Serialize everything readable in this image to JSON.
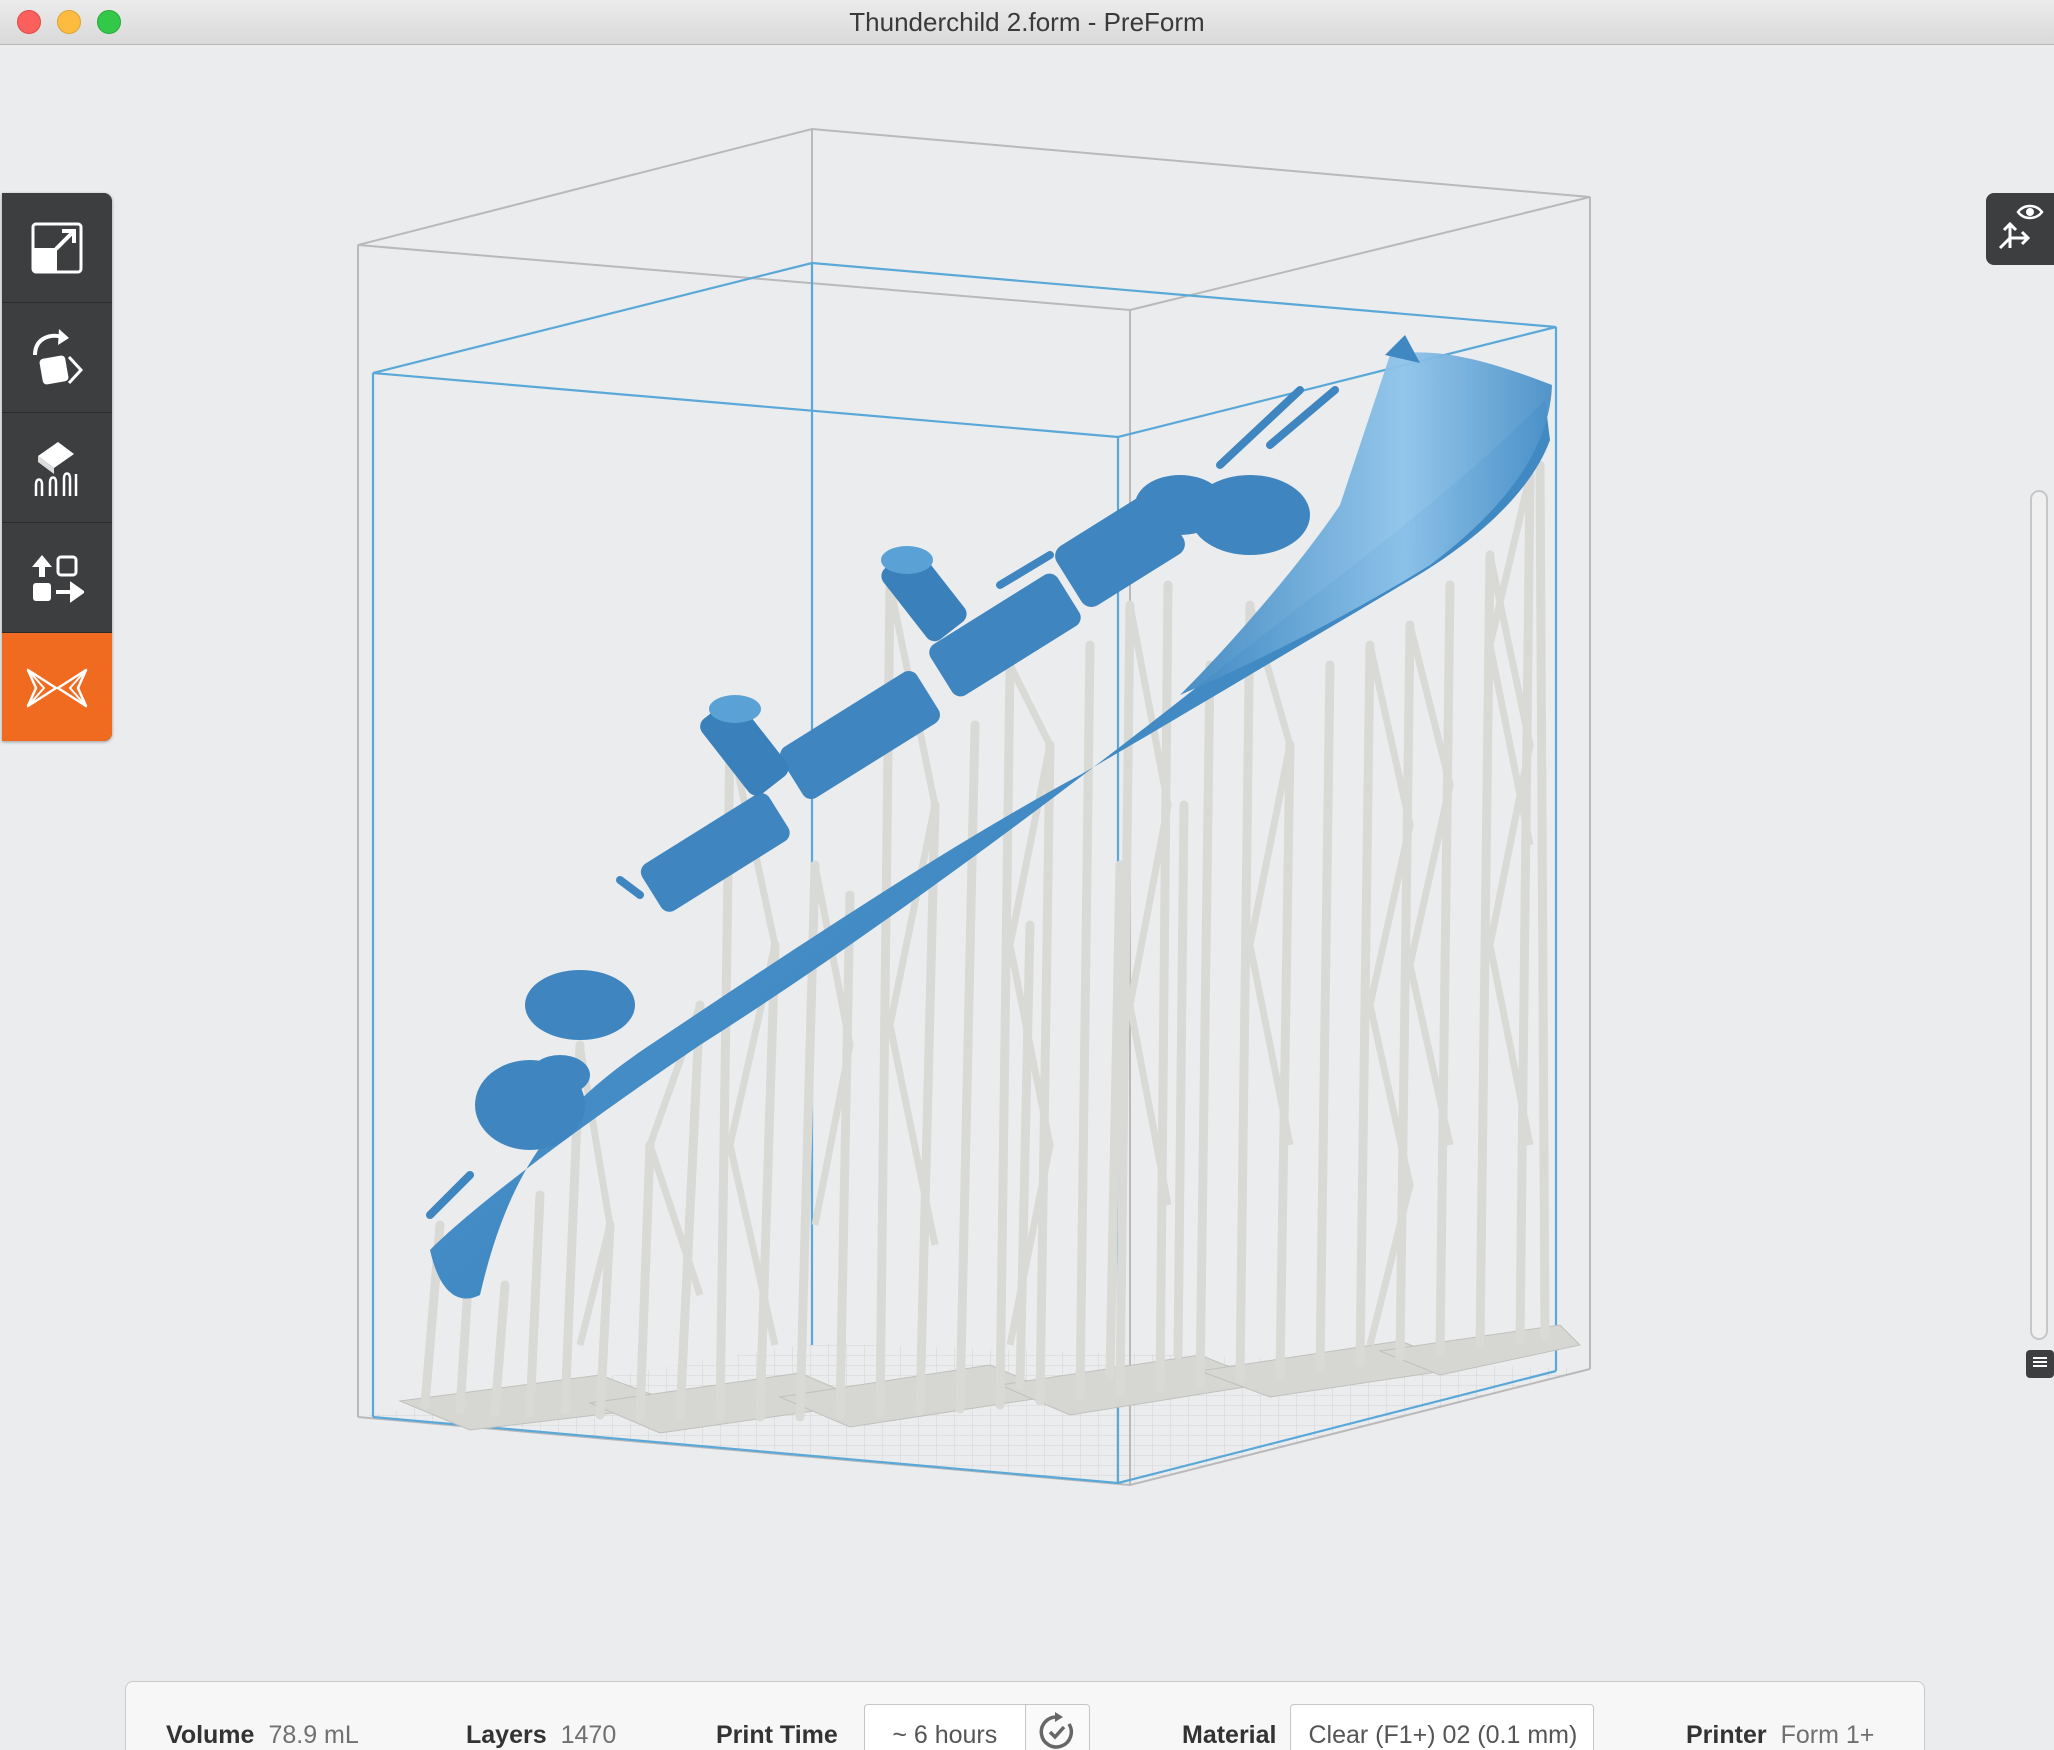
{
  "window": {
    "title": "Thunderchild 2.form - PreForm"
  },
  "toolbar": {
    "items": [
      {
        "name": "scale",
        "icon": "scale-icon"
      },
      {
        "name": "orientation",
        "icon": "rotate-icon"
      },
      {
        "name": "supports",
        "icon": "supports-icon"
      },
      {
        "name": "layout",
        "icon": "layout-icon"
      },
      {
        "name": "print",
        "icon": "formlabs-logo-icon",
        "active": true
      }
    ]
  },
  "view_panel": {
    "icon": "view-eye-icon"
  },
  "scene": {
    "model_color": "#4a90c8",
    "support_color": "#d9d9d6",
    "build_volume_color": "#5aa8d8"
  },
  "status": {
    "volume": {
      "label": "Volume",
      "value": "78.9 mL"
    },
    "layers": {
      "label": "Layers",
      "value": "1470"
    },
    "print_time": {
      "label": "Print Time",
      "value": "~ 6 hours"
    },
    "material": {
      "label": "Material",
      "value": "Clear (F1+) 02 (0.1 mm)"
    },
    "printer": {
      "label": "Printer",
      "value": "Form 1+"
    }
  },
  "colors": {
    "accent": "#f06b1f",
    "toolbar_bg": "#3d3e40",
    "canvas_bg": "#ebecee"
  }
}
